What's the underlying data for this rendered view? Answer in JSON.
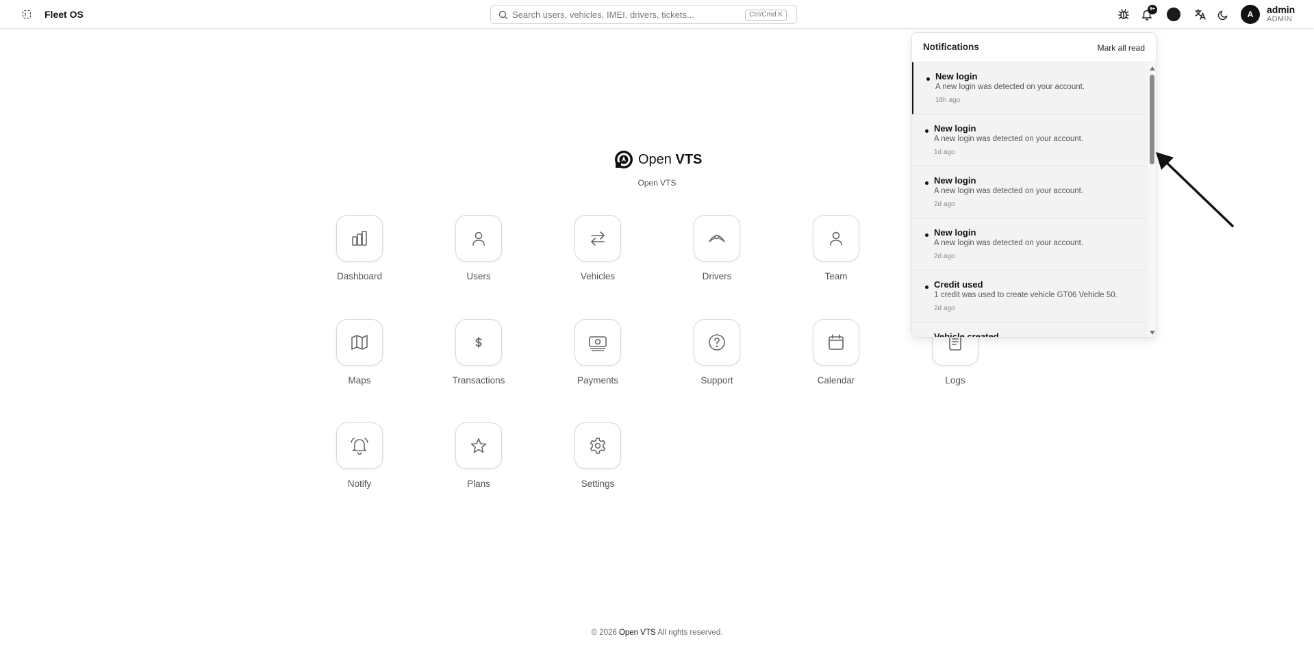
{
  "app": {
    "title": "Fleet OS"
  },
  "search": {
    "placeholder": "Search users, vehicles, IMEI, drivers, tickets...",
    "shortcut": "Ctrl/Cmd K"
  },
  "topbar": {
    "notification_badge": "9+",
    "user": {
      "avatar_initial": "A",
      "name": "admin",
      "role": "ADMIN"
    }
  },
  "brand": {
    "name": "Open VTS",
    "name_prefix": "Open",
    "name_suffix": "VTS",
    "subtitle": "Open VTS"
  },
  "modules": [
    {
      "label": "Dashboard",
      "icon": "bar-chart-icon"
    },
    {
      "label": "Users",
      "icon": "user-icon"
    },
    {
      "label": "Vehicles",
      "icon": "swap-arrows-icon"
    },
    {
      "label": "Drivers",
      "icon": "steering-wheel-icon"
    },
    {
      "label": "Team",
      "icon": "user-icon"
    },
    {
      "label": "Maps",
      "icon": "map-icon"
    },
    {
      "label": "Transactions",
      "icon": "dollar-icon"
    },
    {
      "label": "Payments",
      "icon": "banknote-icon"
    },
    {
      "label": "Support",
      "icon": "help-circle-icon"
    },
    {
      "label": "Calendar",
      "icon": "calendar-icon"
    },
    {
      "label": "Logs",
      "icon": "document-icon"
    },
    {
      "label": "Notify",
      "icon": "bell-ringing-icon"
    },
    {
      "label": "Plans",
      "icon": "star-icon"
    },
    {
      "label": "Settings",
      "icon": "gear-icon"
    }
  ],
  "notifications": {
    "title": "Notifications",
    "mark_all_read": "Mark all read",
    "items": [
      {
        "title": "New login",
        "body": "A new login was detected on your account.",
        "time": "16h ago"
      },
      {
        "title": "New login",
        "body": "A new login was detected on your account.",
        "time": "1d ago"
      },
      {
        "title": "New login",
        "body": "A new login was detected on your account.",
        "time": "2d ago"
      },
      {
        "title": "New login",
        "body": "A new login was detected on your account.",
        "time": "2d ago"
      },
      {
        "title": "Credit used",
        "body": "1 credit was used to create vehicle GT06 Vehicle 50.",
        "time": "2d ago"
      },
      {
        "title": "Vehicle created",
        "body": "",
        "time": ""
      }
    ]
  },
  "footer": {
    "copyright": "© 2026",
    "brand": "Open VTS",
    "rights": "All rights reserved."
  }
}
